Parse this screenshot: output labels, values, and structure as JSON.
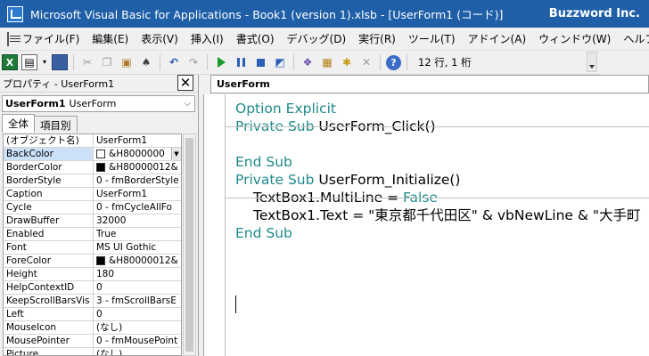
{
  "titlebar": {
    "title": "Microsoft Visual Basic for Applications - Book1 (version 1).xlsb - [UserForm1 (コード)]",
    "brand": "Buzzword Inc."
  },
  "menu": {
    "items": [
      "ファイル(F)",
      "編集(E)",
      "表示(V)",
      "挿入(I)",
      "書式(O)",
      "デバッグ(D)",
      "実行(R)",
      "ツール(T)",
      "アドイン(A)",
      "ウィンドウ(W)",
      "ヘルプ(H)"
    ]
  },
  "toolbar": {
    "status": "12 行, 1 桁",
    "icons": [
      "excel-icon",
      "insert-userform-icon",
      "save-icon",
      "cut-icon",
      "copy-icon",
      "paste-icon",
      "find-icon",
      "undo-icon",
      "redo-icon",
      "run-icon",
      "pause-icon",
      "stop-icon",
      "design-mode-icon",
      "project-explorer-icon",
      "properties-icon",
      "object-browser-icon",
      "toolbox-icon",
      "help-icon"
    ]
  },
  "properties": {
    "title": "プロパティ - UserForm1",
    "object_name": "UserForm1",
    "object_type": "UserForm",
    "tabs": [
      "全体",
      "項目別"
    ],
    "rows": [
      {
        "name": "(オブジェクト名)",
        "value": "UserForm1",
        "swatch": ""
      },
      {
        "name": "BackColor",
        "value": "&H8000000",
        "swatch": "white",
        "dropdown": true
      },
      {
        "name": "BorderColor",
        "value": "&H80000012&",
        "swatch": "black"
      },
      {
        "name": "BorderStyle",
        "value": "0 - fmBorderStyle",
        "swatch": ""
      },
      {
        "name": "Caption",
        "value": "UserForm1",
        "swatch": ""
      },
      {
        "name": "Cycle",
        "value": "0 - fmCycleAllFo",
        "swatch": ""
      },
      {
        "name": "DrawBuffer",
        "value": "32000",
        "swatch": ""
      },
      {
        "name": "Enabled",
        "value": "True",
        "swatch": ""
      },
      {
        "name": "Font",
        "value": "MS UI Gothic",
        "swatch": ""
      },
      {
        "name": "ForeColor",
        "value": "&H80000012&",
        "swatch": "black"
      },
      {
        "name": "Height",
        "value": "180",
        "swatch": ""
      },
      {
        "name": "HelpContextID",
        "value": "0",
        "swatch": ""
      },
      {
        "name": "KeepScrollBarsVis",
        "value": "3 - fmScrollBarsE",
        "swatch": ""
      },
      {
        "name": "Left",
        "value": "0",
        "swatch": ""
      },
      {
        "name": "MouseIcon",
        "value": "(なし)",
        "swatch": ""
      },
      {
        "name": "MousePointer",
        "value": "0 - fmMousePoint",
        "swatch": ""
      },
      {
        "name": "Picture",
        "value": "(なし)",
        "swatch": ""
      }
    ]
  },
  "code": {
    "object_selector": "UserForm",
    "blocks": [
      [
        {
          "kw": "Option Explicit",
          "rest": "",
          "indent": false
        }
      ],
      [
        {
          "kw": "Private Sub",
          "rest": " UserForm_Click()",
          "indent": false
        },
        {
          "kw": "",
          "rest": "",
          "indent": false
        },
        {
          "kw": "End Sub",
          "rest": "",
          "indent": false
        }
      ],
      [
        {
          "kw": "Private Sub",
          "rest": " UserForm_Initialize()",
          "indent": false
        },
        {
          "kw": "",
          "rest": "TextBox1.MultiLine = ",
          "kw2": "False",
          "indent": true
        },
        {
          "kw": "",
          "rest": "TextBox1.Text = \"東京都千代田区\" & vbNewLine & \"大手町",
          "indent": true
        },
        {
          "kw": "End Sub",
          "rest": "",
          "indent": false
        }
      ]
    ]
  },
  "colors": {
    "titlebar": "#1e5fa8",
    "keyword": "#1f8a8a"
  }
}
